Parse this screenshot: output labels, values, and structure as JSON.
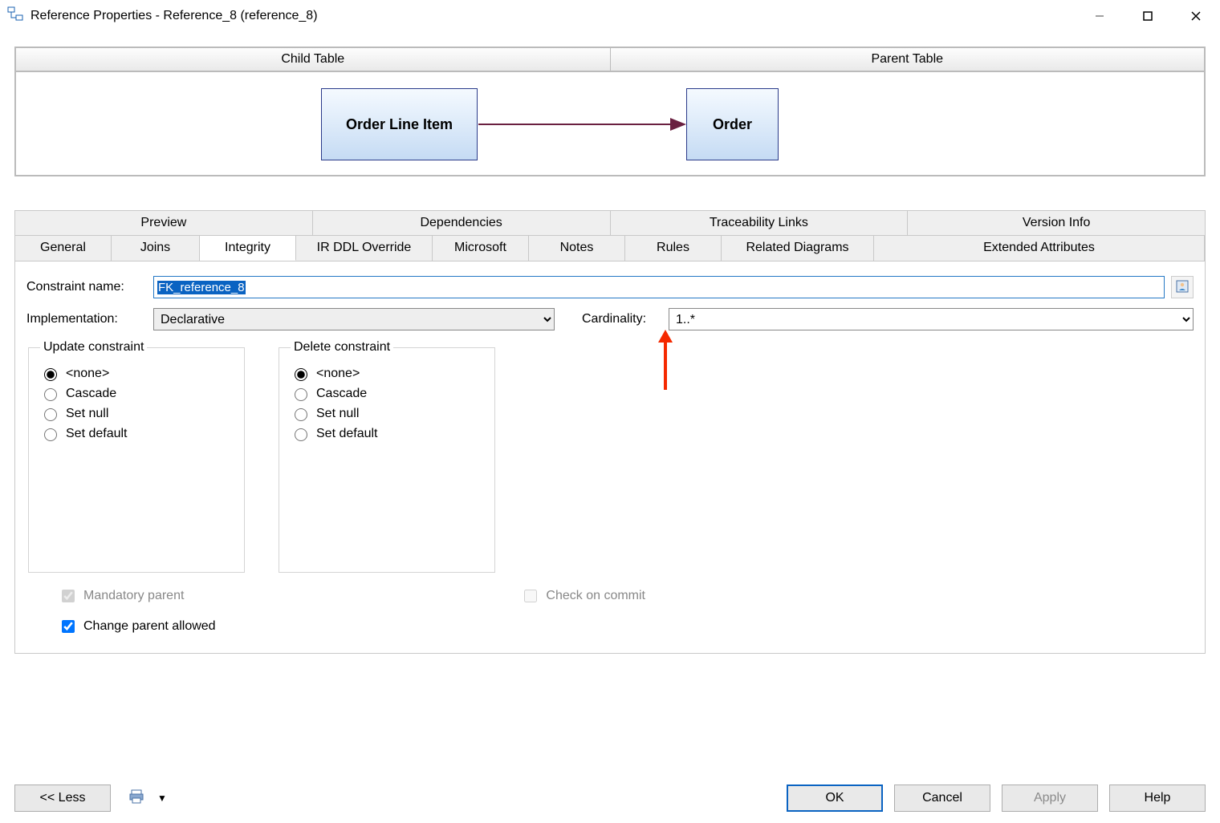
{
  "window": {
    "title": "Reference Properties - Reference_8 (reference_8)"
  },
  "relation": {
    "child_header": "Child Table",
    "parent_header": "Parent Table",
    "child_entity": "Order Line Item",
    "parent_entity": "Order"
  },
  "tabs_row1": {
    "preview": "Preview",
    "dependencies": "Dependencies",
    "traceability": "Traceability Links",
    "version": "Version Info"
  },
  "tabs_row2": {
    "general": "General",
    "joins": "Joins",
    "integrity": "Integrity",
    "irddl": "IR DDL Override",
    "microsoft": "Microsoft",
    "notes": "Notes",
    "rules": "Rules",
    "related": "Related Diagrams",
    "extended": "Extended Attributes"
  },
  "fields": {
    "constraint_label": "Constraint name:",
    "constraint_value": "FK_reference_8",
    "implementation_label": "Implementation:",
    "implementation_value": "Declarative",
    "cardinality_label": "Cardinality:",
    "cardinality_value": "1..*"
  },
  "update_group": {
    "legend": "Update constraint",
    "none": "<none>",
    "cascade": "Cascade",
    "setnull": "Set null",
    "setdefault": "Set default",
    "selected": "none"
  },
  "delete_group": {
    "legend": "Delete constraint",
    "none": "<none>",
    "cascade": "Cascade",
    "setnull": "Set null",
    "setdefault": "Set default",
    "selected": "none"
  },
  "checks": {
    "mandatory": "Mandatory parent",
    "check_commit": "Check on commit",
    "change_parent": "Change parent allowed"
  },
  "footer": {
    "less": "<< Less",
    "ok": "OK",
    "cancel": "Cancel",
    "apply": "Apply",
    "help": "Help"
  }
}
